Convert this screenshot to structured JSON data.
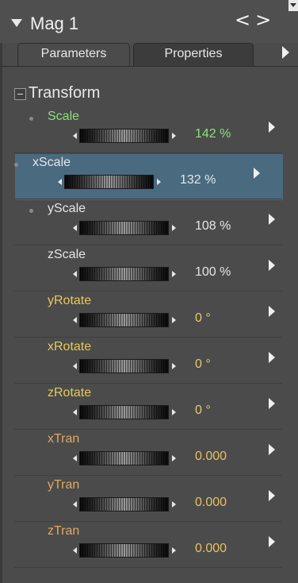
{
  "panel": {
    "title": "Mag 1",
    "nav": "<>",
    "tabs": [
      "Parameters",
      "Properties"
    ],
    "group": "Transform"
  },
  "colors": {
    "green": "#8be07a",
    "white": "#e8e8e8",
    "orange": "#e8c060",
    "yellow_label": "#e6c95a",
    "selected_bg": "#4a6a80"
  },
  "params": [
    {
      "label": "Scale",
      "value": "142 %",
      "label_color": "green",
      "value_color": "green",
      "dot": true,
      "selected": false
    },
    {
      "label": "xScale",
      "value": "132 %",
      "label_color": "white",
      "value_color": "white",
      "dot": true,
      "selected": true
    },
    {
      "label": "yScale",
      "value": "108 %",
      "label_color": "white",
      "value_color": "white",
      "dot": true,
      "selected": false
    },
    {
      "label": "zScale",
      "value": "100 %",
      "label_color": "white",
      "value_color": "white",
      "dot": false,
      "selected": false
    },
    {
      "label": "yRotate",
      "value": "0 °",
      "label_color": "yellow",
      "value_color": "yellow",
      "dot": false,
      "selected": false
    },
    {
      "label": "xRotate",
      "value": "0 °",
      "label_color": "yellow",
      "value_color": "yellow",
      "dot": false,
      "selected": false
    },
    {
      "label": "zRotate",
      "value": "0 °",
      "label_color": "yellow",
      "value_color": "yellow",
      "dot": false,
      "selected": false
    },
    {
      "label": "xTran",
      "value": "0.000",
      "label_color": "orange",
      "value_color": "orange",
      "dot": false,
      "selected": false
    },
    {
      "label": "yTran",
      "value": "0.000",
      "label_color": "orange",
      "value_color": "orange",
      "dot": false,
      "selected": false
    },
    {
      "label": "zTran",
      "value": "0.000",
      "label_color": "orange",
      "value_color": "orange",
      "dot": false,
      "selected": false
    }
  ]
}
